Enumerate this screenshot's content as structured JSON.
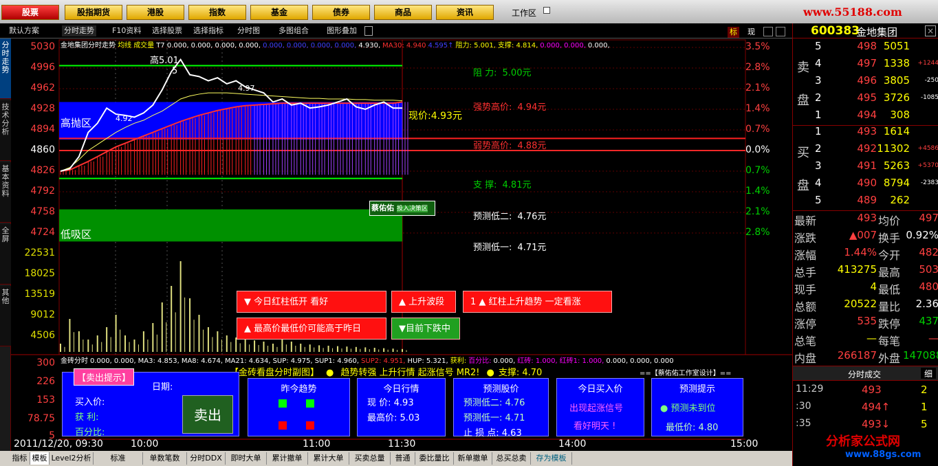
{
  "topnav": [
    "股票",
    "股指期货",
    "港股",
    "指数",
    "基金",
    "债券",
    "商品",
    "资讯"
  ],
  "workzone": "工作区",
  "site_logo": "www.55188.com",
  "toolbar": [
    "默认方案",
    "分时走势",
    "F10资料",
    "选择股票",
    "选择指标",
    "分时图",
    "多图组合",
    "图形叠加"
  ],
  "toolbar_right": [
    "标",
    "现"
  ],
  "side_tabs": [
    "分时走势",
    "技术分析",
    "基本资料",
    "全屏",
    "其他"
  ],
  "stock": {
    "code": "600383",
    "name": "金地集团"
  },
  "chart_title": "金地集团分时走势",
  "legend_items": [
    "均线",
    "成交量",
    "T7 0.000,",
    "0.000,",
    "0.000,",
    "0.000,",
    "0.000,",
    "0.000,",
    "0.000,",
    "0.000,",
    "4.930,",
    "MA30: 4.940",
    "4.595↑",
    "阻力: 5.001,",
    "支撑: 4.814,",
    "0.000,",
    "0.000,",
    "0.000,"
  ],
  "y_left": [
    "5030",
    "4996",
    "4962",
    "4928",
    "4894",
    "4860",
    "4826",
    "4792",
    "4758",
    "4724"
  ],
  "y_right": [
    "3.5%",
    "2.8%",
    "2.1%",
    "1.4%",
    "0.7%",
    "0.0%",
    "0.7%",
    "1.4%",
    "2.1%",
    "2.8%"
  ],
  "vol_axis": [
    "22531",
    "18025",
    "13519",
    "9012",
    "4506"
  ],
  "price_notes": {
    "high": "高5.01",
    "high2": "5",
    "mid": "4.97",
    "low": "4.92",
    "hp_zone": "高抛区",
    "lp_zone": "低吸区",
    "current": "现价:4.93元"
  },
  "levels": [
    {
      "label": "阻   力:",
      "value": "5.00元",
      "color": "#00d000"
    },
    {
      "label": "强势高价:",
      "value": "4.94元",
      "color": "#ff3030"
    },
    {
      "label": "弱势高价:",
      "value": "4.88元",
      "color": "#ff3030"
    },
    {
      "label": "支   撑:",
      "value": "4.81元",
      "color": "#00d000"
    },
    {
      "label": "预测低二:",
      "value": "4.76元",
      "color": "#ffffff"
    },
    {
      "label": "预测低一:",
      "value": "4.71元",
      "color": "#ffffff"
    }
  ],
  "badge": {
    "name": "蔡佑佑",
    "sub": "投入决策区"
  },
  "signals": [
    "▼  今日红柱低开    看好",
    "▲  上升波段",
    "1  ▲  红柱上升趋势    一定看涨",
    "▲  最高价最低价可能高于昨日",
    "▼目前下跌中"
  ],
  "sub_legend": [
    "金砖分时",
    "0.000,",
    "0.000,",
    "MA3: 4.853,",
    "MA8: 4.674,",
    "MA21: 4.634,",
    "SUP: 4.975,",
    "SUP1: 4.960,",
    "SUP2: 4.951,",
    "HUP: 5.321,",
    "获利:",
    "百分比:",
    "0.000,",
    "红砖: 1.000,",
    "红砖1: 1.000,",
    "0.000,",
    "0.000,",
    "0.000"
  ],
  "sub_title": "【金砖看盘分时副图】",
  "sub_signal": "趋势转强  上升行情  起涨信号  MR2!",
  "sub_support": "支撑: 4.70",
  "sub_design": "==【蔡佑佑工作室设计】==",
  "sub_axis": [
    "300",
    "226",
    "153",
    "78.75",
    "5"
  ],
  "panels": {
    "sell": {
      "title": "【卖出提示】",
      "date": "日期:",
      "buy": "买入价:",
      "profit": "获  利:",
      "pct": "百分比:",
      "btn": "卖出"
    },
    "trend": {
      "title": "昨今趋势"
    },
    "today": {
      "title": "今日行情",
      "cur": "现  价: 4.93",
      "high": "最高价: 5.03"
    },
    "pred": {
      "title": "预测股价",
      "l2": "预测低二: 4.76",
      "l1": "预测低一: 4.71",
      "stop": "止  损  点: 4.63"
    },
    "buyp": {
      "title": "今日买入价",
      "s1": "出现起涨信号",
      "s2": "看好明天 !"
    },
    "tip": {
      "title": "预测提示",
      "s1": "预测未到位",
      "s2": "最低价: 4.80"
    }
  },
  "time_axis": [
    "2011/12/20, 09:30",
    "10:00",
    "11:00",
    "11:30",
    "14:00",
    "15:00"
  ],
  "sell_orders": [
    {
      "n": "5",
      "p": "498",
      "v": "5051",
      "c": ""
    },
    {
      "n": "4",
      "p": "497",
      "v": "1338",
      "c": "+1244"
    },
    {
      "n": "3",
      "p": "496",
      "v": "3805",
      "c": "-250"
    },
    {
      "n": "2",
      "p": "495",
      "v": "3726",
      "c": "-1085"
    },
    {
      "n": "1",
      "p": "494",
      "v": "308",
      "c": ""
    }
  ],
  "buy_orders": [
    {
      "n": "1",
      "p": "493",
      "v": "1614",
      "c": ""
    },
    {
      "n": "2",
      "p": "492",
      "v": "11302",
      "c": "+4586"
    },
    {
      "n": "3",
      "p": "491",
      "v": "5263",
      "c": "+5370"
    },
    {
      "n": "4",
      "p": "490",
      "v": "8794",
      "c": "-2383"
    },
    {
      "n": "5",
      "p": "489",
      "v": "262",
      "c": ""
    }
  ],
  "sell_label": [
    "卖",
    "盘"
  ],
  "buy_label": [
    "买",
    "盘"
  ],
  "stats": [
    {
      "l": "最新",
      "v": "493",
      "l2": "均价",
      "v2": "497"
    },
    {
      "l": "涨跌",
      "v": "▲007",
      "l2": "换手",
      "v2": "0.92%"
    },
    {
      "l": "涨幅",
      "v": "1.44%",
      "l2": "今开",
      "v2": "482"
    },
    {
      "l": "总手",
      "v": "413275",
      "l2": "最高",
      "v2": "503"
    },
    {
      "l": "现手",
      "v": "4",
      "l2": "最低",
      "v2": "480"
    },
    {
      "l": "总额",
      "v": "20522",
      "l2": "量比",
      "v2": "2.36"
    },
    {
      "l": "涨停",
      "v": "535",
      "l2": "跌停",
      "v2": "437"
    },
    {
      "l": "总笔",
      "v": "—",
      "l2": "每笔",
      "v2": "—"
    },
    {
      "l": "内盘",
      "v": "266187",
      "l2": "外盘",
      "v2": "147088"
    }
  ],
  "ticks_title": "分时成交",
  "ticks_btn": "细",
  "ticks": [
    {
      "t": "11:29",
      "p": "493",
      "v": "2"
    },
    {
      "t": ":30",
      "p": "494↑",
      "v": "1"
    },
    {
      "t": ":35",
      "p": "493↓",
      "v": "5"
    }
  ],
  "bottom_tabs": [
    "指标",
    "模板",
    "Level2分析",
    "标准",
    "单数笔数",
    "分时DDX",
    "即时大单",
    "累计撤单",
    "累计大单",
    "买卖总量",
    "普通",
    "委比量比",
    "新单撤单",
    "总买总卖",
    "存为模板"
  ],
  "watermark": "分析家公式网",
  "watermark_url": "www.88gs.com",
  "series": {
    "price": [
      4826,
      4830,
      4850,
      4890,
      4905,
      4930,
      4920,
      4918,
      4915,
      4922,
      4935,
      4960,
      4990,
      5010,
      4985,
      4982,
      4975,
      4980,
      4970,
      4975,
      4965,
      4960,
      4955,
      4940,
      4945,
      4935,
      4938,
      4930,
      4932,
      4935,
      4940,
      4945,
      4932,
      4928,
      4935,
      4940,
      4930,
      4930
    ],
    "avg": [
      4826,
      4832,
      4845,
      4860,
      4870,
      4880,
      4890,
      4898,
      4905,
      4910,
      4918,
      4925,
      4935,
      4945,
      4950,
      4953,
      4955,
      4955,
      4955,
      4954,
      4953,
      4952,
      4951,
      4950,
      4949,
      4948,
      4947,
      4946,
      4946,
      4945,
      4945,
      4945,
      4944,
      4944,
      4943,
      4943,
      4943,
      4942
    ],
    "ma30": [
      4826,
      4828,
      4835,
      4842,
      4850,
      4858,
      4866,
      4872,
      4878,
      4884,
      4890,
      4896,
      4902,
      4908,
      4913,
      4918,
      4922,
      4926,
      4929,
      4932,
      4934,
      4935,
      4936,
      4937,
      4938,
      4938,
      4938,
      4938,
      4938,
      4938,
      4938,
      4938,
      4938,
      4938,
      4938,
      4938,
      4938,
      4940
    ],
    "volume": [
      2000,
      8000,
      5000,
      3000,
      4000,
      6000,
      9000,
      4000,
      3000,
      5000,
      7000,
      12000,
      16000,
      22000,
      13000,
      9000,
      6000,
      5000,
      4000,
      3500,
      3000,
      2800,
      2500,
      2000,
      3000,
      2500,
      2000,
      1800,
      1600,
      1500,
      1400,
      1300,
      1200,
      1100,
      1000,
      900,
      800,
      700
    ]
  }
}
